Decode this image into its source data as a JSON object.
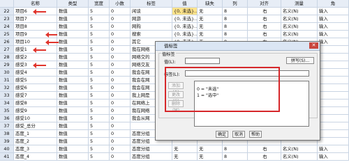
{
  "columns": [
    "名称",
    "类型",
    "宽度",
    "小数",
    "标签",
    "值",
    "缺失",
    "列",
    "对齐",
    "测量",
    "角"
  ],
  "rows": [
    {
      "num": "22",
      "name": "项目6",
      "type": "数值",
      "width": "5",
      "dec": "0",
      "label": "闲谈",
      "value": "{0, 未选}...",
      "missing": "无",
      "cols": "8",
      "align": "右",
      "measure": "名义(N)",
      "role": "输入"
    },
    {
      "num": "23",
      "name": "项目7",
      "type": "数值",
      "width": "5",
      "dec": "0",
      "label": "网游",
      "value": "{0, 未选}...",
      "missing": "无",
      "cols": "8",
      "align": "右",
      "measure": "名义(N)",
      "role": "输入"
    },
    {
      "num": "24",
      "name": "项目8",
      "type": "数值",
      "width": "5",
      "dec": "0",
      "label": "网购",
      "value": "{0, 未选}...",
      "missing": "无",
      "cols": "8",
      "align": "右",
      "measure": "名义(N)",
      "role": "输入"
    },
    {
      "num": "25",
      "name": "项目9",
      "type": "数值",
      "width": "5",
      "dec": "0",
      "label": "搜索",
      "value": "{0, 未选}...",
      "missing": "无",
      "cols": "8",
      "align": "右",
      "measure": "名义(N)",
      "role": "输入"
    },
    {
      "num": "26",
      "name": "项目10",
      "type": "数值",
      "width": "5",
      "dec": "0",
      "label": "其它",
      "value": "{0, 未选}...",
      "missing": "无",
      "cols": "8",
      "align": "右",
      "measure": "名义(N)",
      "role": "输入"
    },
    {
      "num": "27",
      "name": "感受1",
      "type": "数值",
      "width": "5",
      "dec": "0",
      "label": "我在网络",
      "value": "",
      "missing": "",
      "cols": "",
      "align": "",
      "measure": "",
      "role": ""
    },
    {
      "num": "28",
      "name": "感受2",
      "type": "数值",
      "width": "5",
      "dec": "0",
      "label": "网络交的",
      "value": "",
      "missing": "",
      "cols": "",
      "align": "",
      "measure": "",
      "role": ""
    },
    {
      "num": "29",
      "name": "感受3",
      "type": "数值",
      "width": "5",
      "dec": "0",
      "label": "网络交友",
      "value": "",
      "missing": "",
      "cols": "",
      "align": "",
      "measure": "",
      "role": ""
    },
    {
      "num": "30",
      "name": "感受4",
      "type": "数值",
      "width": "5",
      "dec": "0",
      "label": "我会在网",
      "value": "",
      "missing": "",
      "cols": "",
      "align": "",
      "measure": "",
      "role": ""
    },
    {
      "num": "31",
      "name": "感受5",
      "type": "数值",
      "width": "5",
      "dec": "0",
      "label": "我会在网",
      "value": "",
      "missing": "",
      "cols": "",
      "align": "",
      "measure": "",
      "role": ""
    },
    {
      "num": "32",
      "name": "感受6",
      "type": "数值",
      "width": "5",
      "dec": "0",
      "label": "我会在网",
      "value": "",
      "missing": "",
      "cols": "",
      "align": "",
      "measure": "",
      "role": ""
    },
    {
      "num": "33",
      "name": "感受7",
      "type": "数值",
      "width": "5",
      "dec": "0",
      "label": "我上网是",
      "value": "",
      "missing": "",
      "cols": "",
      "align": "",
      "measure": "",
      "role": ""
    },
    {
      "num": "34",
      "name": "感受8",
      "type": "数值",
      "width": "5",
      "dec": "0",
      "label": "在网络上",
      "value": "",
      "missing": "",
      "cols": "",
      "align": "",
      "measure": "",
      "role": ""
    },
    {
      "num": "35",
      "name": "感受9",
      "type": "数值",
      "width": "5",
      "dec": "0",
      "label": "我在网络",
      "value": "",
      "missing": "",
      "cols": "",
      "align": "",
      "measure": "",
      "role": ""
    },
    {
      "num": "36",
      "name": "感受10",
      "type": "数值",
      "width": "5",
      "dec": "0",
      "label": "我会从网",
      "value": "",
      "missing": "",
      "cols": "",
      "align": "",
      "measure": "",
      "role": ""
    },
    {
      "num": "37",
      "name": "感受_总分",
      "type": "数值",
      "width": "5",
      "dec": "0",
      "label": "",
      "value": "",
      "missing": "",
      "cols": "",
      "align": "",
      "measure": "",
      "role": ""
    },
    {
      "num": "38",
      "name": "态度_1",
      "type": "数值",
      "width": "5",
      "dec": "0",
      "label": "态度分组",
      "value": "",
      "missing": "",
      "cols": "",
      "align": "",
      "measure": "",
      "role": ""
    },
    {
      "num": "39",
      "name": "态度_2",
      "type": "数值",
      "width": "5",
      "dec": "0",
      "label": "态度分组",
      "value": "",
      "missing": "",
      "cols": "",
      "align": "",
      "measure": "",
      "role": ""
    },
    {
      "num": "40",
      "name": "态度_3",
      "type": "数值",
      "width": "5",
      "dec": "0",
      "label": "态度分组",
      "value": "无",
      "missing": "无",
      "cols": "8",
      "align": "右",
      "measure": "名义(N)",
      "role": "输入"
    },
    {
      "num": "41",
      "name": "态度_4",
      "type": "数值",
      "width": "5",
      "dec": "0",
      "label": "态度分组",
      "value": "无",
      "missing": "无",
      "cols": "8",
      "align": "右",
      "measure": "名义(N)",
      "role": "输入"
    }
  ],
  "dialog": {
    "title": "值标签",
    "group_label": "值标签",
    "value_label": "值(L):",
    "label_label": "标签(L):",
    "spell_button": "拼写(S)...",
    "add_button": "添加(A)",
    "change_button": "更改(C)",
    "remove_button": "删除(M)",
    "list_items": [
      "0 = \"未选\"",
      "1 = \"选中\""
    ],
    "ok_button": "确定",
    "cancel_button": "取消",
    "help_button": "帮助"
  },
  "colors": {
    "red_marker": "#e0342c",
    "highlight": "#ffe48c"
  }
}
